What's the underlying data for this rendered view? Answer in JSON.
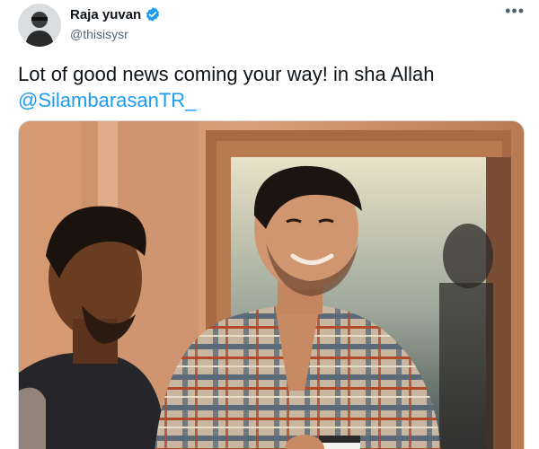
{
  "tweet": {
    "display_name": "Raja yuvan",
    "handle": "@thisisysr",
    "text": "Lot of good news coming your way! in sha Allah",
    "mention": "@SilambarasanTR_",
    "more_icon": "more-horizontal-icon",
    "verified_icon": "verified-badge-icon"
  },
  "colors": {
    "accent": "#1d9bf0",
    "text": "#0f1419",
    "secondary": "#536471"
  }
}
